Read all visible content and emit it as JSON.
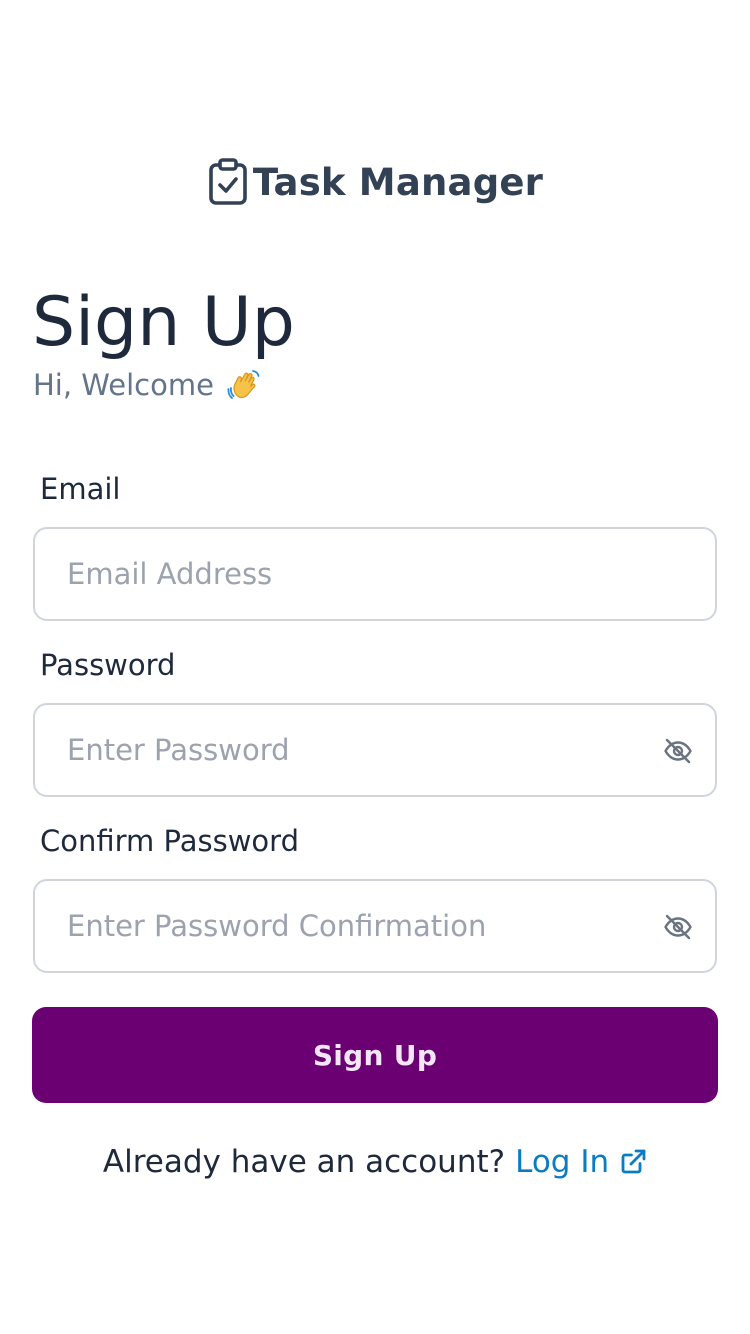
{
  "brand": {
    "icon": "clipboard-check-icon",
    "name": "Task Manager"
  },
  "heading": {
    "title": "Sign Up",
    "subtitle": "Hi, Welcome",
    "emoji_icon": "waving-hand-icon"
  },
  "form": {
    "email": {
      "label": "Email",
      "placeholder": "Email Address",
      "value": ""
    },
    "password": {
      "label": "Password",
      "placeholder": "Enter Password",
      "value": "",
      "toggle_icon": "eye-off-icon"
    },
    "confirm_password": {
      "label": "Confirm Password",
      "placeholder": "Enter Password Confirmation",
      "value": "",
      "toggle_icon": "eye-off-icon"
    },
    "submit_label": "Sign Up"
  },
  "footer": {
    "prompt": "Already have an account?",
    "link_label": "Log In",
    "link_icon": "external-link-icon"
  },
  "colors": {
    "primary": "#6b0073",
    "link": "#0b7cc4",
    "heading": "#1e293b",
    "muted": "#64748b",
    "border": "#d1d5db"
  }
}
